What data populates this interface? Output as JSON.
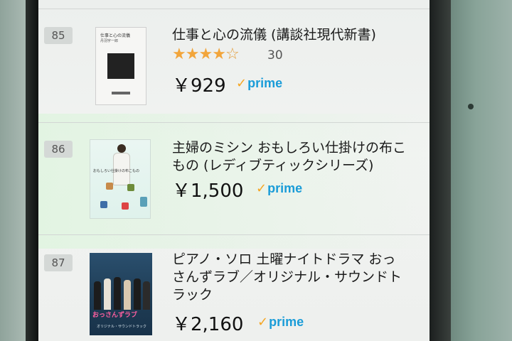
{
  "results": [
    {
      "rank": "85",
      "title": "仕事と心の流儀 (講談社現代新書)",
      "rating": 4,
      "rating_max": 5,
      "review_count": "30",
      "price": "￥929",
      "prime": "prime",
      "cover": {
        "title": "仕事と心の流儀",
        "author": "丹羽宇一郎"
      }
    },
    {
      "rank": "86",
      "title_line1": "主婦のミシン おもしろい仕掛けの布こ",
      "title_line2": "もの (レディブティックシリーズ)",
      "price": "￥1,500",
      "prime": "prime",
      "cover": {
        "subtitle": "おもしろい仕掛けの布こもの"
      }
    },
    {
      "rank": "87",
      "title_line1": "ピアノ・ソロ 土曜ナイトドラマ おっ",
      "title_line2": "さんずラブ／オリジナル・サウンドト",
      "title_line3": "ラック",
      "price": "￥2,160",
      "prime": "prime",
      "cover": {
        "logo": "おっさんずラブ",
        "subtitle": "オリジナル・サウンドトラック"
      }
    }
  ],
  "colors": {
    "star": "#f2a53b",
    "prime_blue": "#1a9cd8",
    "prime_check": "#f5a623"
  },
  "icons": {
    "star_full": "★",
    "star_empty": "☆",
    "prime_check": "✓"
  }
}
